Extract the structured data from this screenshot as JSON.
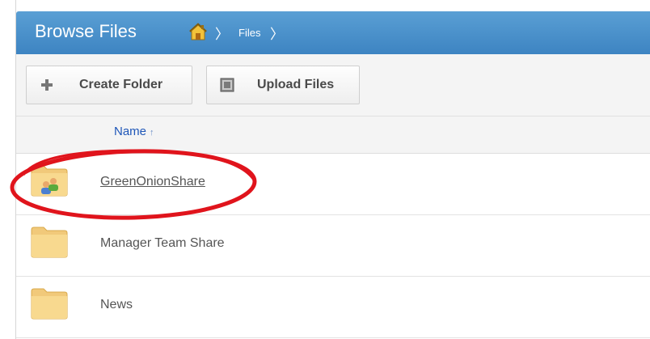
{
  "header": {
    "title": "Browse Files",
    "breadcrumb": [
      {
        "icon": "home-icon"
      },
      {
        "label": "Files"
      }
    ],
    "separator": "〉",
    "color": "#4a90cc"
  },
  "toolbar": {
    "create_folder_label": "Create Folder",
    "create_folder_icon": "plus-icon",
    "upload_files_label": "Upload Files",
    "upload_files_icon": "upload-icon"
  },
  "table": {
    "columns": [
      {
        "label": "Name",
        "sort": "ascending"
      }
    ],
    "sort_indicator": "↑",
    "rows": [
      {
        "name": "GreenOnionShare",
        "icon": "shared-folder-icon",
        "highlighted": true
      },
      {
        "name": "Manager Team Share",
        "icon": "folder-icon",
        "highlighted": false
      },
      {
        "name": "News",
        "icon": "folder-icon",
        "highlighted": false
      }
    ]
  },
  "annotation": {
    "color": "#e0141c",
    "target": "GreenOnionShare"
  }
}
